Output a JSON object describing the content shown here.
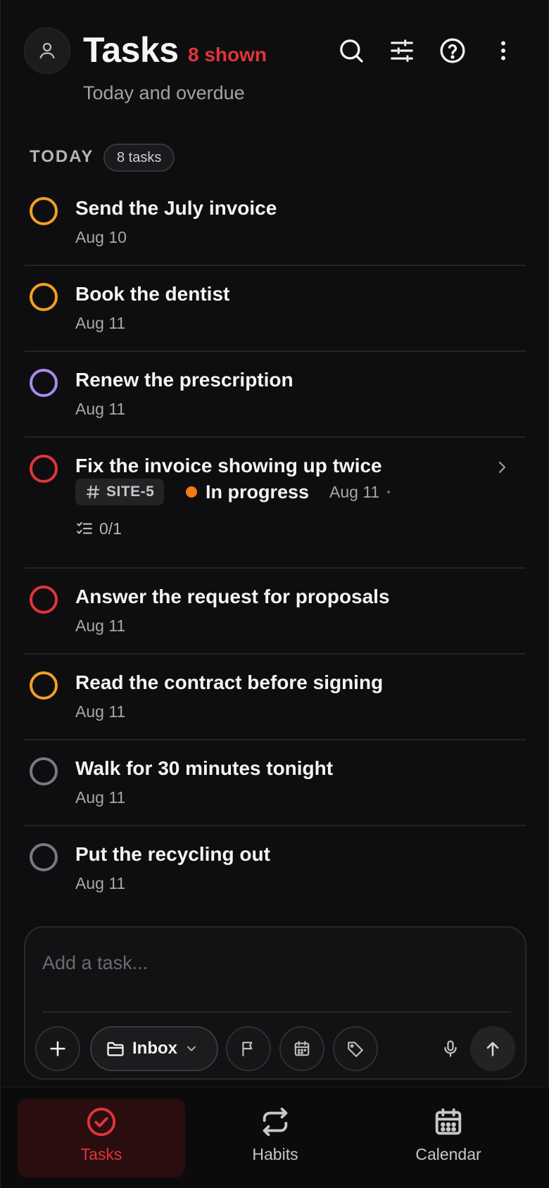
{
  "header": {
    "title": "Tasks",
    "shown_count": "8 shown",
    "subtitle": "Today and overdue"
  },
  "section": {
    "label": "TODAY",
    "count": "8 tasks"
  },
  "tasks": [
    {
      "title": "Send the July invoice",
      "date": "Aug 10",
      "priority_color": "#f0a020"
    },
    {
      "title": "Book the dentist",
      "date": "Aug 11",
      "priority_color": "#f0a020"
    },
    {
      "title": "Renew the prescription",
      "date": "Aug 11",
      "priority_color": "#a98bf0"
    },
    {
      "title": "Fix the invoice showing up twice",
      "date": "Aug 11",
      "priority_color": "#e0353a",
      "tag": "SITE-5",
      "status": "In progress",
      "status_color": "#f07b12",
      "subtasks": "0/1"
    },
    {
      "title": "Answer the request for proposals",
      "date": "Aug 11",
      "priority_color": "#e0353a"
    },
    {
      "title": "Read the contract before signing",
      "date": "Aug 11",
      "priority_color": "#f0a020"
    },
    {
      "title": "Walk for 30 minutes tonight",
      "date": "Aug 11",
      "priority_color": "#7a7a7e"
    },
    {
      "title": "Put the recycling out",
      "date": "Aug 11",
      "priority_color": "#7a7a7e"
    }
  ],
  "composer": {
    "placeholder": "Add a task...",
    "project": "Inbox"
  },
  "nav": {
    "tasks": "Tasks",
    "habits": "Habits",
    "calendar": "Calendar"
  },
  "colors": {
    "accent": "#e0353a",
    "background": "#0e0e10"
  }
}
